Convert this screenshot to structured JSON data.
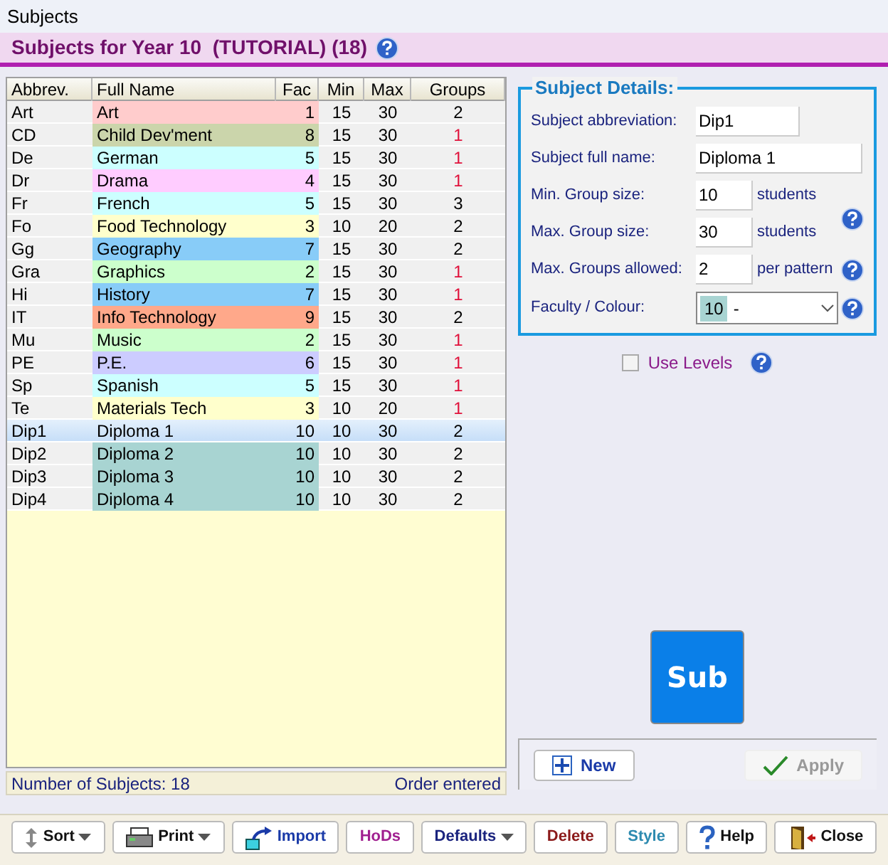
{
  "window": {
    "title": "Subjects"
  },
  "header": {
    "title": "Subjects for Year 10  (TUTORIAL) (18)"
  },
  "table": {
    "columns": [
      "Abbrev.",
      "Full Name",
      "Fac",
      "Min",
      "Max",
      "Groups"
    ],
    "rows": [
      {
        "abbrev": "Art",
        "name": "Art",
        "fac": "1",
        "min": "15",
        "max": "30",
        "groups": "2",
        "color": "#ffcccc",
        "groups_alert": false,
        "selected": false
      },
      {
        "abbrev": "CD",
        "name": "Child Dev'ment",
        "fac": "8",
        "min": "15",
        "max": "30",
        "groups": "1",
        "color": "#cbd5ab",
        "groups_alert": true,
        "selected": false
      },
      {
        "abbrev": "De",
        "name": "German",
        "fac": "5",
        "min": "15",
        "max": "30",
        "groups": "1",
        "color": "#ccffff",
        "groups_alert": true,
        "selected": false
      },
      {
        "abbrev": "Dr",
        "name": "Drama",
        "fac": "4",
        "min": "15",
        "max": "30",
        "groups": "1",
        "color": "#ffccff",
        "groups_alert": true,
        "selected": false
      },
      {
        "abbrev": "Fr",
        "name": "French",
        "fac": "5",
        "min": "15",
        "max": "30",
        "groups": "3",
        "color": "#ccffff",
        "groups_alert": false,
        "selected": false
      },
      {
        "abbrev": "Fo",
        "name": "Food Technology",
        "fac": "3",
        "min": "10",
        "max": "20",
        "groups": "2",
        "color": "#ffffcc",
        "groups_alert": false,
        "selected": false
      },
      {
        "abbrev": "Gg",
        "name": "Geography",
        "fac": "7",
        "min": "15",
        "max": "30",
        "groups": "2",
        "color": "#88ccf8",
        "groups_alert": false,
        "selected": false
      },
      {
        "abbrev": "Gra",
        "name": "Graphics",
        "fac": "2",
        "min": "15",
        "max": "30",
        "groups": "1",
        "color": "#ccffcc",
        "groups_alert": true,
        "selected": false
      },
      {
        "abbrev": "Hi",
        "name": "History",
        "fac": "7",
        "min": "15",
        "max": "30",
        "groups": "1",
        "color": "#88ccf8",
        "groups_alert": true,
        "selected": false
      },
      {
        "abbrev": "IT",
        "name": "Info Technology",
        "fac": "9",
        "min": "15",
        "max": "30",
        "groups": "2",
        "color": "#ffa88a",
        "groups_alert": false,
        "selected": false
      },
      {
        "abbrev": "Mu",
        "name": "Music",
        "fac": "2",
        "min": "15",
        "max": "30",
        "groups": "1",
        "color": "#ccffcc",
        "groups_alert": true,
        "selected": false
      },
      {
        "abbrev": "PE",
        "name": "P.E.",
        "fac": "6",
        "min": "15",
        "max": "30",
        "groups": "1",
        "color": "#ccccff",
        "groups_alert": true,
        "selected": false
      },
      {
        "abbrev": "Sp",
        "name": "Spanish",
        "fac": "5",
        "min": "15",
        "max": "30",
        "groups": "1",
        "color": "#ccffff",
        "groups_alert": true,
        "selected": false
      },
      {
        "abbrev": "Te",
        "name": "Materials Tech",
        "fac": "3",
        "min": "10",
        "max": "20",
        "groups": "1",
        "color": "#ffffcc",
        "groups_alert": true,
        "selected": false
      },
      {
        "abbrev": "Dip1",
        "name": "Diploma 1",
        "fac": "10",
        "min": "10",
        "max": "30",
        "groups": "2",
        "groups_alert": false,
        "selected": true
      },
      {
        "abbrev": "Dip2",
        "name": "Diploma 2",
        "fac": "10",
        "min": "10",
        "max": "30",
        "groups": "2",
        "color": "#a8d4d2",
        "groups_alert": false,
        "selected": false
      },
      {
        "abbrev": "Dip3",
        "name": "Diploma 3",
        "fac": "10",
        "min": "10",
        "max": "30",
        "groups": "2",
        "color": "#a8d4d2",
        "groups_alert": false,
        "selected": false
      },
      {
        "abbrev": "Dip4",
        "name": "Diploma 4",
        "fac": "10",
        "min": "10",
        "max": "30",
        "groups": "2",
        "color": "#a8d4d2",
        "groups_alert": false,
        "selected": false
      }
    ]
  },
  "status_bar": {
    "count": "Number of Subjects: 18",
    "order": "Order entered"
  },
  "details": {
    "legend": "Subject Details:",
    "fields": [
      {
        "label": "Subject abbreviation:",
        "value": "Dip1",
        "kind": "short"
      },
      {
        "label": "Subject full name:",
        "value": "Diploma 1",
        "kind": "long"
      },
      {
        "label": "Min. Group size:",
        "value": "10",
        "kind": "small",
        "unit": "students"
      },
      {
        "label": "Max. Group size:",
        "value": "30",
        "kind": "small",
        "unit": "students"
      },
      {
        "label": "Max. Groups allowed:",
        "value": "2",
        "kind": "small",
        "unit": "per pattern"
      }
    ],
    "faculty": {
      "label": "Faculty / Colour:",
      "code": "10",
      "text": "-",
      "color": "#a8d4d2"
    }
  },
  "use_levels": {
    "label": "Use Levels",
    "checked": false
  },
  "tile": {
    "text": "Sub",
    "color": "#0a7fe8"
  },
  "actions": [
    {
      "label": "New",
      "kind": "new",
      "disabled": false
    },
    {
      "label": "Apply",
      "kind": "apply",
      "disabled": true
    }
  ],
  "toolbar": [
    {
      "label": "Sort",
      "kind": "sort",
      "dropdown": true,
      "color": "#111111"
    },
    {
      "label": "Print",
      "kind": "print",
      "dropdown": true,
      "color": "#111111"
    },
    {
      "label": "Import",
      "kind": "import",
      "dropdown": false,
      "color": "#1a3aa8"
    },
    {
      "label": "HoDs",
      "kind": "plain",
      "dropdown": false,
      "color": "#a01f8f"
    },
    {
      "label": "Defaults",
      "kind": "plain",
      "dropdown": true,
      "color": "#1a237e"
    },
    {
      "label": "Delete",
      "kind": "plain",
      "dropdown": false,
      "color": "#8b1a1a"
    },
    {
      "label": "Style",
      "kind": "plain",
      "dropdown": false,
      "color": "#2e8bb0"
    },
    {
      "label": "Help",
      "kind": "help",
      "dropdown": false,
      "color": "#111111"
    },
    {
      "label": "Close",
      "kind": "close",
      "dropdown": false,
      "color": "#111111"
    }
  ]
}
